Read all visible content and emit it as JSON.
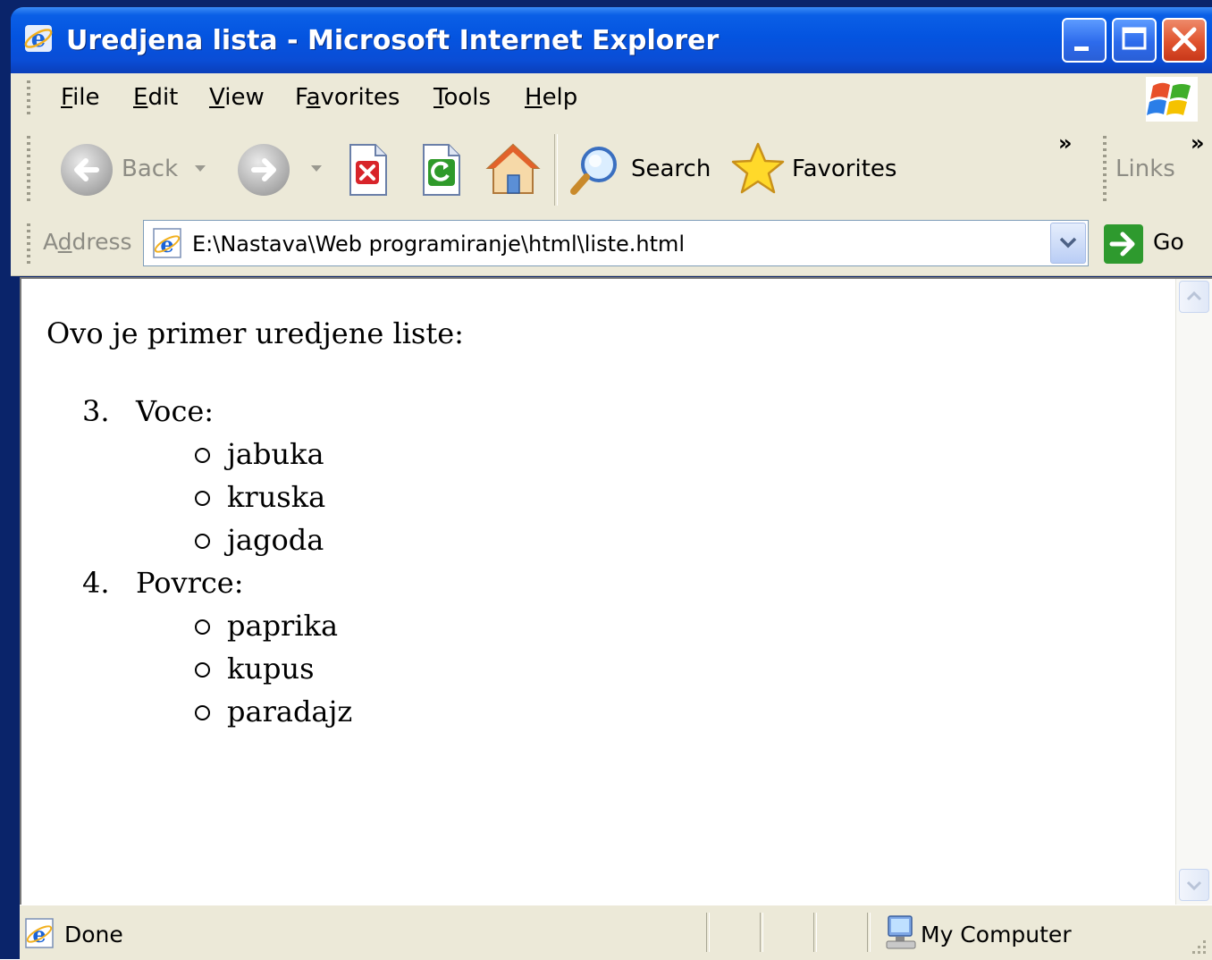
{
  "window": {
    "title": "Uredjena lista - Microsoft Internet Explorer"
  },
  "menu": {
    "items": [
      {
        "key": "F",
        "rest": "ile"
      },
      {
        "key": "E",
        "rest": "dit"
      },
      {
        "key": "V",
        "rest": "iew"
      },
      {
        "pre": "F",
        "key": "a",
        "rest": "vorites"
      },
      {
        "key": "T",
        "rest": "ools"
      },
      {
        "key": "H",
        "rest": "elp"
      }
    ]
  },
  "toolbar": {
    "back_label": "Back",
    "search_label": "Search",
    "favorites_label": "Favorites",
    "chevron": "»",
    "links_label": "Links",
    "links_chevron": "»"
  },
  "address": {
    "label_pre": "A",
    "label_key": "d",
    "label_rest": "dress",
    "value": "E:\\Nastava\\Web programiranje\\html\\liste.html",
    "go_label": "Go"
  },
  "page": {
    "intro": "Ovo je primer uredjene liste:",
    "list": [
      {
        "number": "3.",
        "label": "Voce:",
        "items": [
          "jabuka",
          "kruska",
          "jagoda"
        ]
      },
      {
        "number": "4.",
        "label": "Povrce:",
        "items": [
          "paprika",
          "kupus",
          "paradajz"
        ]
      }
    ]
  },
  "status": {
    "text": "Done",
    "zone": "My Computer"
  },
  "colors": {
    "titlebar": "#0454E0",
    "chrome": "#ECE9D8",
    "close_button": "#E0532E",
    "go_arrow": "#2E9A2E"
  }
}
